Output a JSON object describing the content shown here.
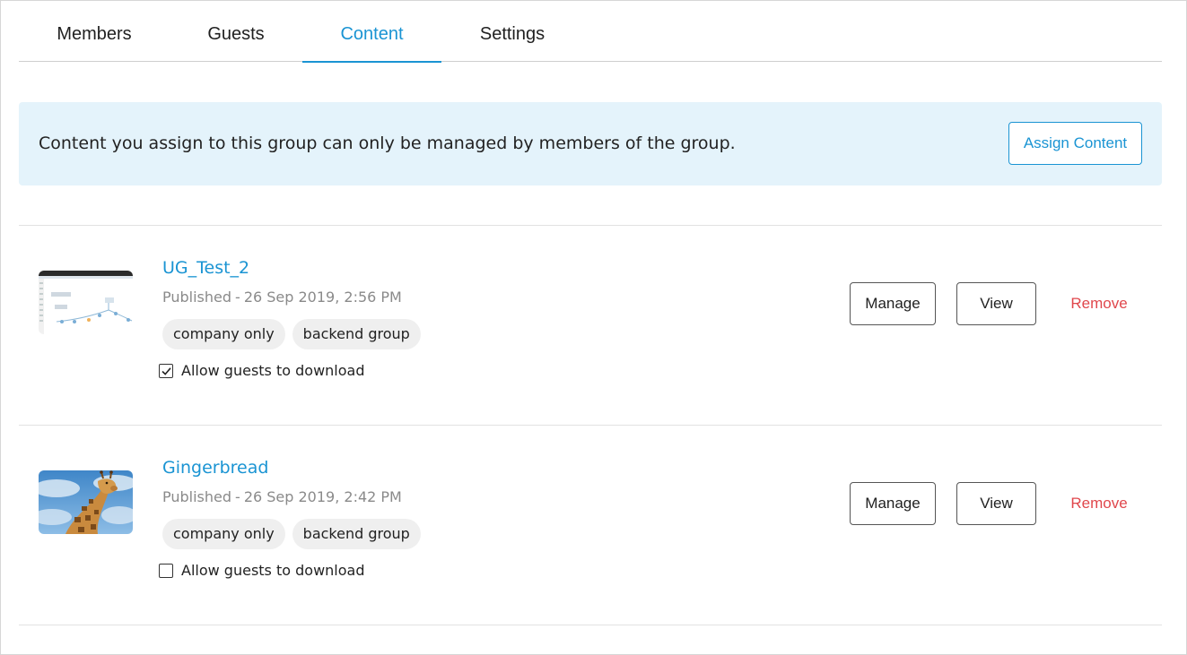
{
  "tabs": [
    {
      "label": "Members"
    },
    {
      "label": "Guests"
    },
    {
      "label": "Content",
      "active": true
    },
    {
      "label": "Settings"
    }
  ],
  "banner": {
    "text": "Content you assign to this group can only be managed by members of the group.",
    "button_label": "Assign Content"
  },
  "items": [
    {
      "title": "UG_Test_2",
      "status": "Published",
      "separator": "-",
      "date": "26 Sep 2019, 2:56 PM",
      "tags": [
        "company only",
        "backend group"
      ],
      "download_label": "Allow guests to download",
      "download_checked": true,
      "thumbnail": "diagram-screenshot",
      "actions": {
        "manage": "Manage",
        "view": "View",
        "remove": "Remove"
      }
    },
    {
      "title": "Gingerbread",
      "status": "Published",
      "separator": "-",
      "date": "26 Sep 2019, 2:42 PM",
      "tags": [
        "company only",
        "backend group"
      ],
      "download_label": "Allow guests to download",
      "download_checked": false,
      "thumbnail": "giraffe-photo",
      "actions": {
        "manage": "Manage",
        "view": "View",
        "remove": "Remove"
      }
    }
  ],
  "colors": {
    "accent": "#1a94d3",
    "banner_bg": "#e4f3fb",
    "remove": "#e0474c",
    "tag_bg": "#efefef"
  }
}
